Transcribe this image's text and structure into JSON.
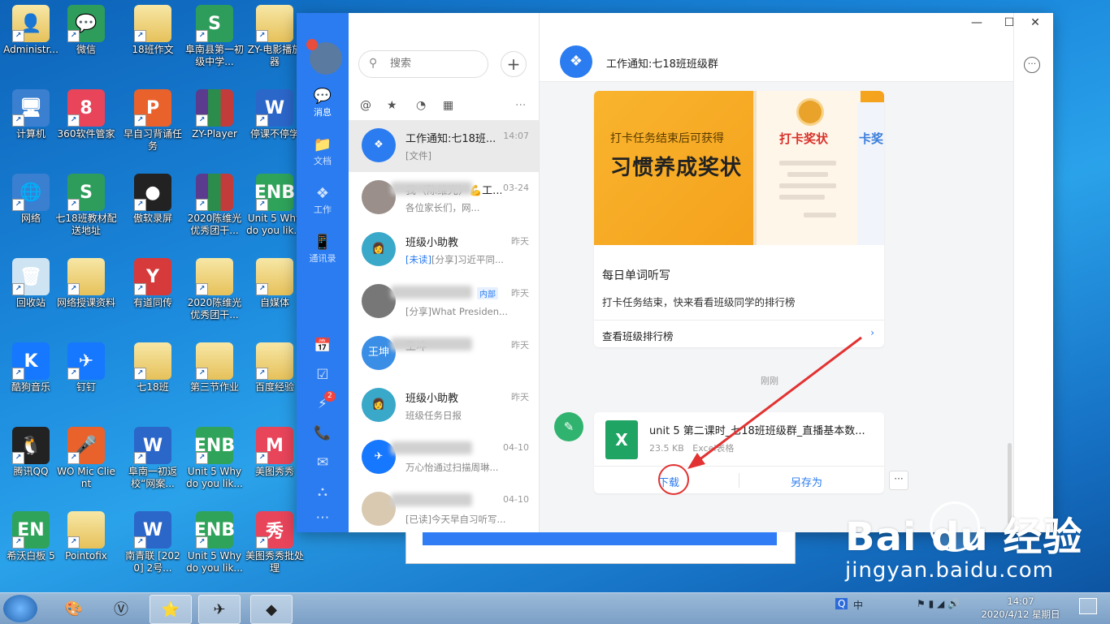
{
  "desktop": {
    "icons": [
      {
        "label": "Administr...",
        "glyph": "👤",
        "cls": "folder"
      },
      {
        "label": "微信",
        "glyph": "💬",
        "cls": "g-green"
      },
      {
        "label": "18班作文",
        "glyph": "",
        "cls": "folder"
      },
      {
        "label": "阜南县第一初级中学...",
        "glyph": "S",
        "cls": "g-green"
      },
      {
        "label": "ZY-电影播放器",
        "glyph": "",
        "cls": "folder"
      },
      {
        "label": "计算机",
        "glyph": "🖥",
        "cls": "g-comp"
      },
      {
        "label": "360软件管家",
        "glyph": "8",
        "cls": "g-pink"
      },
      {
        "label": "早自习背诵任务",
        "glyph": "P",
        "cls": "g-orange"
      },
      {
        "label": "ZY-Player",
        "glyph": "",
        "cls": "g-winrar"
      },
      {
        "label": "停课不停学",
        "glyph": "W",
        "cls": "g-word"
      },
      {
        "label": "网络",
        "glyph": "🌐",
        "cls": "g-comp"
      },
      {
        "label": "七18班教材配送地址",
        "glyph": "S",
        "cls": "g-green"
      },
      {
        "label": "傲软录屏",
        "glyph": "●",
        "cls": "g-dark"
      },
      {
        "label": "2020陈维光优秀团干...",
        "glyph": "",
        "cls": "g-winrar"
      },
      {
        "label": "Unit 5 Why do you lik...",
        "glyph": "ENB",
        "cls": "g-enb"
      },
      {
        "label": "回收站",
        "glyph": "🗑",
        "cls": "g-trash"
      },
      {
        "label": "网络授课资料",
        "glyph": "",
        "cls": "folder"
      },
      {
        "label": "有道同传",
        "glyph": "Y",
        "cls": "g-red"
      },
      {
        "label": "2020陈维光优秀团干...",
        "glyph": "",
        "cls": "folder"
      },
      {
        "label": "自媒体",
        "glyph": "",
        "cls": "folder"
      },
      {
        "label": "酷狗音乐",
        "glyph": "K",
        "cls": "g-blue"
      },
      {
        "label": "钉钉",
        "glyph": "✈",
        "cls": "g-blue"
      },
      {
        "label": "七18班",
        "glyph": "",
        "cls": "folder"
      },
      {
        "label": "第三节作业",
        "glyph": "",
        "cls": "folder"
      },
      {
        "label": "百度经验",
        "glyph": "",
        "cls": "folder"
      },
      {
        "label": "腾讯QQ",
        "glyph": "🐧",
        "cls": "g-dark"
      },
      {
        "label": "WO Mic Client",
        "glyph": "🎤",
        "cls": "g-orange"
      },
      {
        "label": "阜南一初返校“网案...",
        "glyph": "W",
        "cls": "g-word"
      },
      {
        "label": "Unit 5 Why do you lik...",
        "glyph": "ENB",
        "cls": "g-enb"
      },
      {
        "label": "美图秀秀",
        "glyph": "M",
        "cls": "g-pink"
      },
      {
        "label": "希沃白板 5",
        "glyph": "EN",
        "cls": "g-enb"
      },
      {
        "label": "Pointofix",
        "glyph": "",
        "cls": "folder"
      },
      {
        "label": "南青联 [2020] 2号...",
        "glyph": "W",
        "cls": "g-word"
      },
      {
        "label": "Unit 5 Why do you lik...",
        "glyph": "ENB",
        "cls": "g-enb"
      },
      {
        "label": "美图秀秀批处理",
        "glyph": "秀",
        "cls": "g-pink"
      }
    ]
  },
  "window": {
    "controls": {
      "minimize": "—",
      "maximize": "☐",
      "close": "✕"
    },
    "rail": {
      "items": [
        {
          "label": "消息",
          "icon": "💬"
        },
        {
          "label": "文档",
          "icon": "📁"
        },
        {
          "label": "工作",
          "icon": "❖"
        },
        {
          "label": "通讯录",
          "icon": "📱"
        }
      ],
      "tools": [
        "📅",
        "☑",
        "⚡",
        "📞",
        "✉",
        "⛬",
        "⋯"
      ],
      "badge_count": "2"
    },
    "search": {
      "placeholder": "搜索"
    },
    "filters": [
      "@",
      "★",
      "◔",
      "▦",
      "···"
    ],
    "conversations": [
      {
        "name": "工作通知:七18班...",
        "time": "14:07",
        "preview": "[文件]",
        "avatar": "❖",
        "color": "#2b7cf0",
        "tag": ""
      },
      {
        "name": "我（陈维光）💪工...",
        "time": "03-24",
        "preview": "各位家长们，网...",
        "avatar": "",
        "color": "#9a8f8a",
        "tag": ""
      },
      {
        "name": "班级小助教",
        "time": "昨天",
        "preview": "[分享]习近平同...",
        "avatar": "👩",
        "color": "#39a8c9",
        "tag": "[未读]"
      },
      {
        "name": "",
        "time": "昨天",
        "preview": "[分享]What Presiden...",
        "avatar": "",
        "color": "#777",
        "tag": "",
        "badge": "内部"
      },
      {
        "name": "王坤",
        "time": "昨天",
        "preview": "",
        "avatar": "王坤",
        "color": "#3a8ee6",
        "tag": ""
      },
      {
        "name": "班级小助教",
        "time": "昨天",
        "preview": "班级任务日报",
        "avatar": "👩",
        "color": "#39a8c9",
        "tag": ""
      },
      {
        "name": "",
        "time": "04-10",
        "preview": "万心怡通过扫描周琳...",
        "avatar": "✈",
        "color": "#1677ff",
        "tag": ""
      },
      {
        "name": "",
        "time": "04-10",
        "preview": "[已读]今天早自习听写...",
        "avatar": "",
        "color": "#d9c9b0",
        "tag": ""
      }
    ],
    "chat": {
      "title": "工作通知:七18班班级群",
      "card": {
        "banner_line1": "打卡任务结束后可获得",
        "banner_line2": "习惯养成奖状",
        "cert_title": "打卡奖状",
        "cert2_title": "卡奖",
        "title": "每日单词听写",
        "desc": "打卡任务结束，快来看看班级同学的排行榜",
        "link": "查看班级排行榜",
        "link_arrow": "›"
      },
      "timestamp": "刚刚",
      "file": {
        "name": "unit 5 第二课时_七18班班级群_直播基本数...",
        "size": "23.5 KB",
        "type": "Excel表格",
        "icon_letter": "X",
        "download": "下载",
        "save_as": "另存为"
      },
      "more": "···"
    }
  },
  "watermark": {
    "brand": "Bai du 经验",
    "url": "jingyan.baidu.com"
  },
  "taskbar": {
    "apps": [
      "🎨",
      "Ⓥ",
      "⭐",
      "✈",
      "◆"
    ],
    "tray": {
      "ime": "中",
      "time": "14:07",
      "date": "2020/4/12 星期日"
    }
  },
  "colors": {
    "accent": "#2b7cf0",
    "annotation": "#e23232"
  }
}
